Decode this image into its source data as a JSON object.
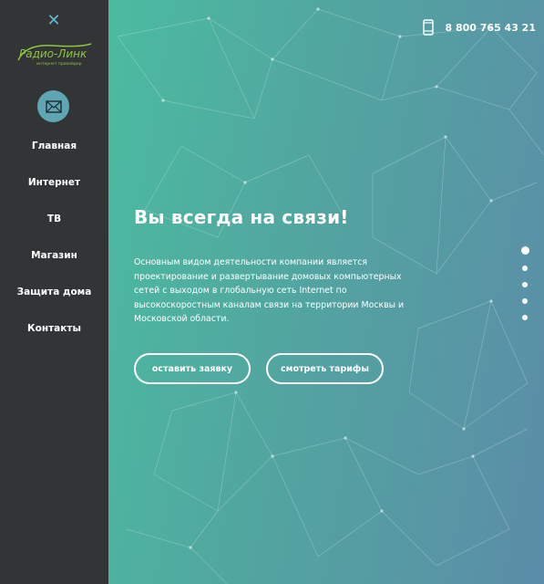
{
  "sidebar": {
    "logo_text": "Радио-Линк",
    "logo_subtext": "интернет провайдер",
    "nav": [
      {
        "label": "Главная"
      },
      {
        "label": "Интернет"
      },
      {
        "label": "ТВ"
      },
      {
        "label": "Магазин"
      },
      {
        "label": "Защита дома"
      },
      {
        "label": "Контакты"
      }
    ],
    "icons": {
      "close": "close-icon",
      "mail": "mail-icon"
    }
  },
  "header": {
    "phone": "8 800 765 43 21",
    "phone_icon": "mobile-phone-icon"
  },
  "hero": {
    "title": "Вы всегда на связи!",
    "description": "Основным видом деятельности компании является проектирование и развертывание домовых компьютерных сетей с выходом в глобальную сеть Internet по высокоскоростным каналам связи на территории Москвы и Московской области.",
    "btn_request": "оставить заявку",
    "btn_tariffs": "смотреть тарифы"
  },
  "slider": {
    "count": 5,
    "active": 1
  },
  "colors": {
    "sidebar_bg": "#323436",
    "accent": "#5fa6b4",
    "gradient_start": "#4bbba0",
    "gradient_end": "#5b8da8",
    "logo_green": "#8dc63f"
  }
}
